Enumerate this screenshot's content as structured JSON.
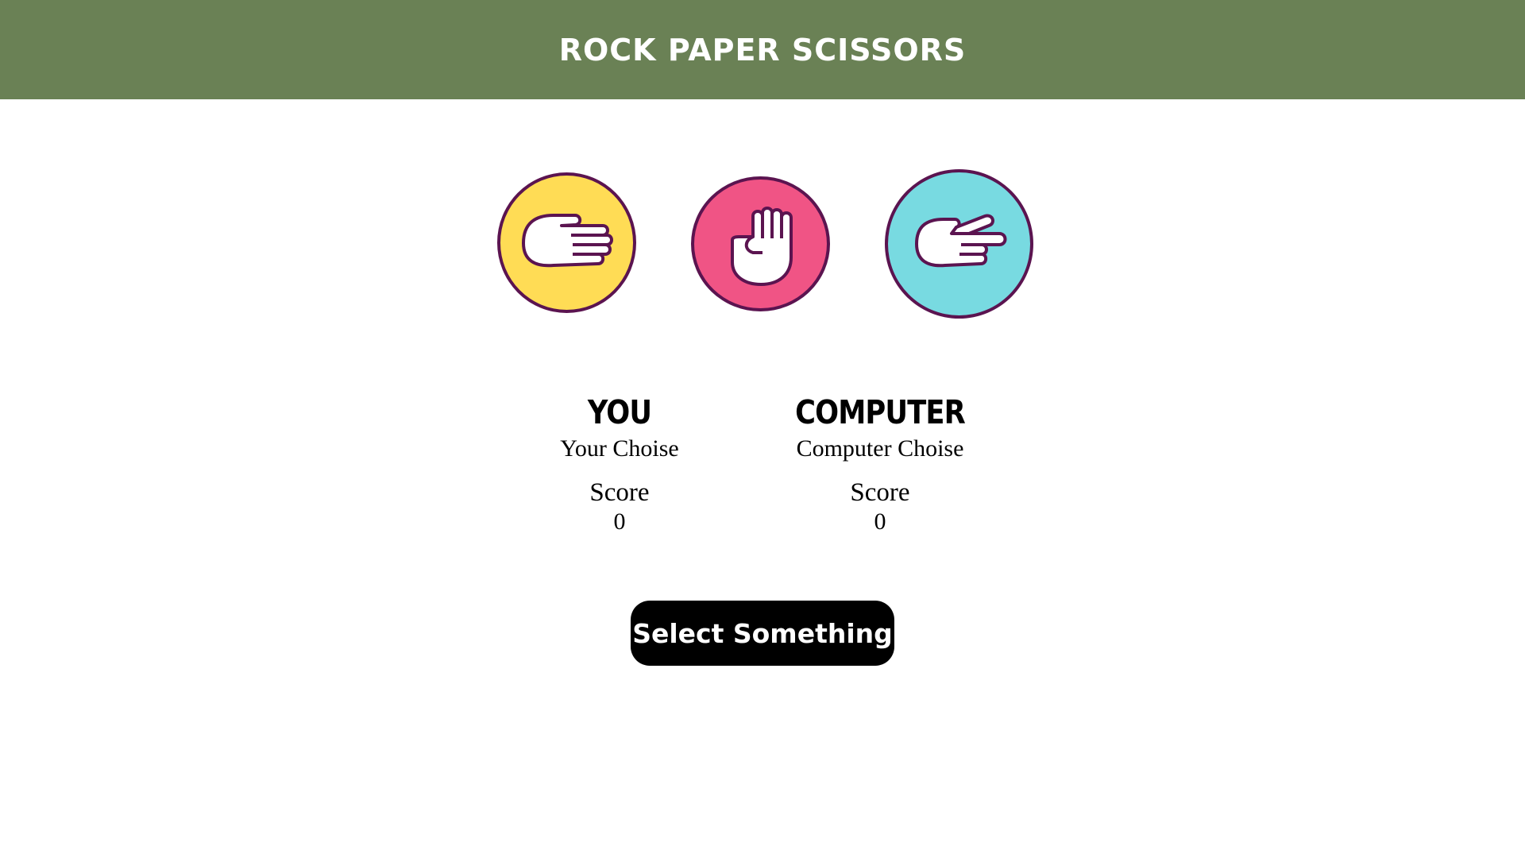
{
  "header": {
    "title": "ROCK PAPER SCISSORS",
    "background": "#6a8155"
  },
  "choices": [
    {
      "id": "paper",
      "icon": "paper-hand-icon",
      "color": "#ffdc55"
    },
    {
      "id": "rock",
      "icon": "rock-fist-icon",
      "color": "#f05485"
    },
    {
      "id": "scissors",
      "icon": "scissors-hand-icon",
      "color": "#78dae1"
    }
  ],
  "outline_color": "#5b1450",
  "players": {
    "you": {
      "title": "YOU",
      "choice": "Your Choise",
      "score_label": "Score",
      "score": "0"
    },
    "computer": {
      "title": "COMPUTER",
      "choice": "Computer Choise",
      "score_label": "Score",
      "score": "0"
    }
  },
  "action_button": {
    "label": "Select Something"
  }
}
